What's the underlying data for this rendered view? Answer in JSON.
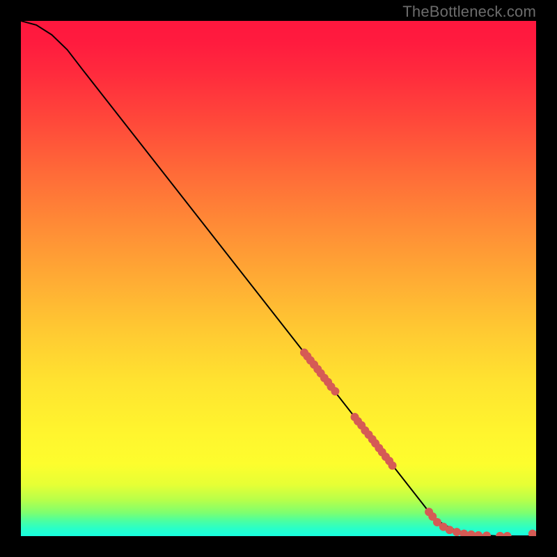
{
  "watermark": "TheBottleneck.com",
  "chart_data": {
    "type": "line",
    "note": "Axes are unlabeled in the source image; values are normalized 0–100 on both axes, estimated from pixel geometry.",
    "xlim": [
      0,
      100
    ],
    "ylim": [
      0,
      100
    ],
    "title": "",
    "xlabel": "",
    "ylabel": "",
    "series": [
      {
        "name": "curve",
        "color": "#000000",
        "x": [
          0,
          3,
          6,
          9,
          12,
          80,
          82,
          84,
          86,
          88,
          90,
          92,
          94,
          99.2
        ],
        "y": [
          100,
          99.2,
          97.3,
          94.4,
          90.5,
          3.7,
          2.3,
          1.3,
          0.7,
          0.35,
          0.15,
          0.05,
          0,
          0
        ]
      }
    ],
    "markers": [
      {
        "name": "dots",
        "color": "#d55b55",
        "radius_px": 6,
        "points": [
          [
            55.0,
            35.6
          ],
          [
            55.6,
            34.9
          ],
          [
            56.2,
            34.1
          ],
          [
            56.9,
            33.3
          ],
          [
            57.6,
            32.4
          ],
          [
            58.2,
            31.6
          ],
          [
            58.9,
            30.7
          ],
          [
            59.6,
            29.9
          ],
          [
            60.2,
            29.0
          ],
          [
            61.0,
            28.1
          ],
          [
            64.8,
            23.1
          ],
          [
            65.4,
            22.3
          ],
          [
            66.1,
            21.5
          ],
          [
            66.8,
            20.5
          ],
          [
            67.5,
            19.7
          ],
          [
            68.2,
            18.8
          ],
          [
            68.8,
            18.0
          ],
          [
            69.5,
            17.1
          ],
          [
            70.1,
            16.3
          ],
          [
            70.8,
            15.4
          ],
          [
            71.5,
            14.6
          ],
          [
            72.1,
            13.7
          ],
          [
            79.2,
            4.7
          ],
          [
            79.9,
            3.8
          ],
          [
            80.8,
            2.7
          ],
          [
            82.0,
            1.8
          ],
          [
            83.2,
            1.2
          ],
          [
            84.6,
            0.8
          ],
          [
            86.0,
            0.45
          ],
          [
            87.4,
            0.3
          ],
          [
            88.8,
            0.16
          ],
          [
            90.4,
            0.08
          ],
          [
            93.0,
            0.02
          ],
          [
            94.4,
            0.0
          ],
          [
            99.3,
            0.45
          ]
        ]
      }
    ],
    "background": {
      "type": "vertical-gradient",
      "stops": [
        [
          0,
          "#ff173e"
        ],
        [
          50,
          "#ffab34"
        ],
        [
          80,
          "#fff52e"
        ],
        [
          100,
          "#18ffe0"
        ]
      ]
    }
  }
}
